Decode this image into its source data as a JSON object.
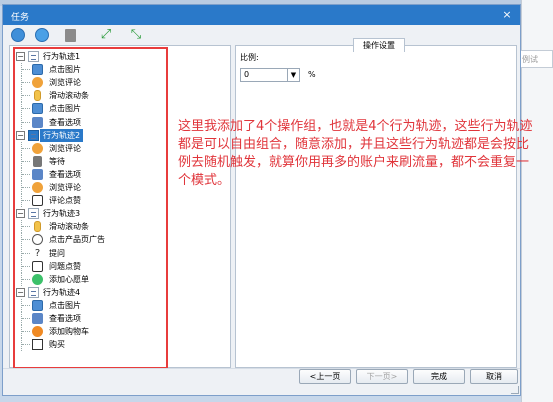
{
  "window": {
    "title": "任务",
    "close_label": "×"
  },
  "background": {
    "right_field_text": "例试"
  },
  "toolbar": {
    "expand_label": "⤢",
    "collapse_label": "⤡"
  },
  "tree": {
    "groups": [
      {
        "label": "行为轨迹1",
        "toggle": "−",
        "selected": false,
        "actions": [
          {
            "label": "点击图片",
            "icon": "image-icon"
          },
          {
            "label": "浏览评论",
            "icon": "comment-icon"
          },
          {
            "label": "滑动滚动条",
            "icon": "scroll-icon"
          },
          {
            "label": "点击图片",
            "icon": "image-icon"
          },
          {
            "label": "查看选项",
            "icon": "view-options-icon"
          }
        ]
      },
      {
        "label": "行为轨迹2",
        "toggle": "−",
        "selected": true,
        "actions": [
          {
            "label": "浏览评论",
            "icon": "comment-icon"
          },
          {
            "label": "等待",
            "icon": "hourglass-icon"
          },
          {
            "label": "查看选项",
            "icon": "view-options-icon"
          },
          {
            "label": "浏览评论",
            "icon": "comment-icon"
          },
          {
            "label": "评论点赞",
            "icon": "thumbs-up-icon"
          }
        ]
      },
      {
        "label": "行为轨迹3",
        "toggle": "−",
        "selected": false,
        "actions": [
          {
            "label": "滑动滚动条",
            "icon": "scroll-icon"
          },
          {
            "label": "点击产品页广告",
            "icon": "ad-icon"
          },
          {
            "label": "提问",
            "icon": "question-icon"
          },
          {
            "label": "问题点赞",
            "icon": "thumbs-up-icon"
          },
          {
            "label": "添加心愿单",
            "icon": "wishlist-icon"
          }
        ]
      },
      {
        "label": "行为轨迹4",
        "toggle": "−",
        "selected": false,
        "actions": [
          {
            "label": "点击图片",
            "icon": "image-icon"
          },
          {
            "label": "查看选项",
            "icon": "view-options-icon"
          },
          {
            "label": "添加购物车",
            "icon": "cart-add-icon"
          },
          {
            "label": "购买",
            "icon": "cart-icon"
          }
        ]
      }
    ]
  },
  "settings": {
    "tab_label": "操作设置",
    "ratio_label": "比例:",
    "ratio_value": "0",
    "ratio_unit": "%"
  },
  "annotation": {
    "text": "这里我添加了4个操作组，也就是4个行为轨迹，这些行为轨迹都是可以自由组合，随意添加，并且这些行为轨迹都是会按比例去随机触发，就算你用再多的账户来刷流量，都不会重复一个模式。"
  },
  "footer": {
    "prev_label": "<上一页",
    "next_label": "下一页>",
    "finish_label": "完成",
    "cancel_label": "取消"
  }
}
